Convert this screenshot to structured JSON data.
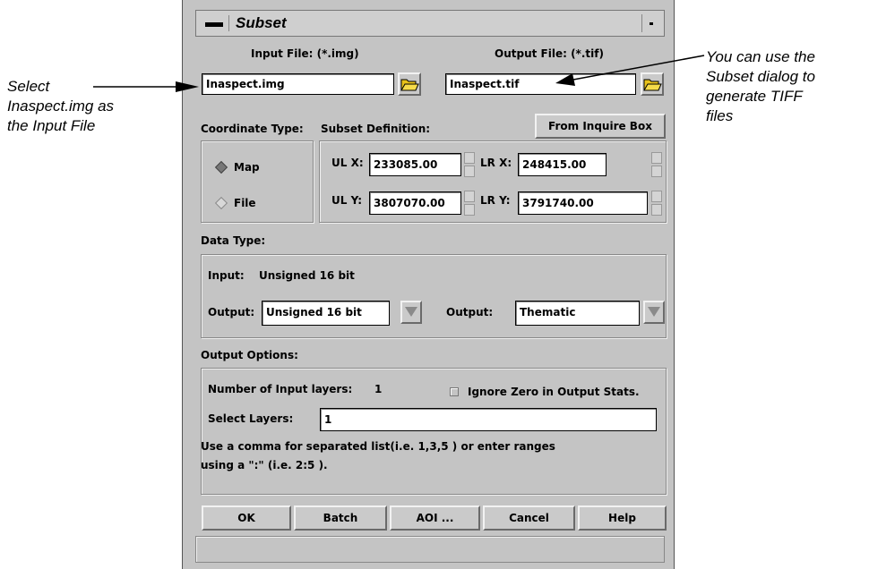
{
  "annotations": {
    "left_line1": "Select",
    "left_line2": "Inaspect.img as",
    "left_line3": "the Input File",
    "right_line1": "You can use the",
    "right_line2": "Subset dialog to",
    "right_line3": "generate TIFF",
    "right_line4": "files"
  },
  "window": {
    "title": "Subset"
  },
  "files": {
    "input_label": "Input File: (*.img)",
    "output_label": "Output File: (*.tif)",
    "input_value": "Inaspect.img",
    "output_value": "Inaspect.tif"
  },
  "coords": {
    "coordinate_type_label": "Coordinate Type:",
    "subset_definition_label": "Subset Definition:",
    "from_inquire_label": "From Inquire Box",
    "map_label": "Map",
    "file_label": "File",
    "selected": "Map",
    "ulx_label": "UL X:",
    "ulx_value": "233085.00",
    "lrx_label": "LR X:",
    "lrx_value": "248415.00",
    "uly_label": "UL Y:",
    "uly_value": "3807070.00",
    "lry_label": "LR Y:",
    "lry_value": "3791740.00"
  },
  "data_type": {
    "heading": "Data Type:",
    "input_label": "Input:",
    "input_value": "Unsigned 16 bit",
    "output_label": "Output:",
    "output_value": "Unsigned 16 bit",
    "output2_label": "Output:",
    "output2_value": "Thematic"
  },
  "output_options": {
    "heading": "Output Options:",
    "num_layers_label": "Number of Input layers:",
    "num_layers_value": "1",
    "ignore_zero_label": "Ignore Zero in Output Stats.",
    "ignore_zero_checked": false,
    "select_layers_label": "Select Layers:",
    "select_layers_value": "1",
    "help_line1": "Use a comma for separated list(i.e. 1,3,5 ) or enter ranges",
    "help_line2": "using a \":\" (i.e. 2:5 )."
  },
  "buttons": {
    "ok": "OK",
    "batch": "Batch",
    "aoi": "AOI ...",
    "cancel": "Cancel",
    "help": "Help"
  },
  "icons": {
    "window_menu": "window-menu-icon",
    "minimize": "minimize-icon",
    "folder": "folder-open-icon",
    "dropdown": "dropdown-arrow-icon"
  }
}
